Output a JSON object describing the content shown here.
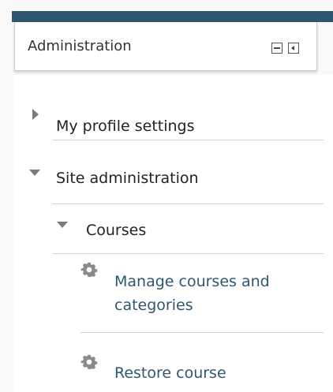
{
  "block": {
    "title": "Administration",
    "minimize_icon": "minimize-icon",
    "dock_icon": "dock-left-icon"
  },
  "nav": {
    "my_profile_settings": {
      "label": "My profile settings",
      "state": "collapsed"
    },
    "site_administration": {
      "label": "Site administration",
      "state": "expanded"
    },
    "courses": {
      "label": "Courses",
      "state": "expanded"
    },
    "links": [
      {
        "label_line1": "Manage courses and",
        "label_line2": "categories",
        "icon": "gear-icon"
      },
      {
        "label_line1": "Restore course",
        "icon": "gear-icon"
      }
    ]
  },
  "colors": {
    "header_bar": "#2f5671",
    "link": "#2f5671",
    "arrow": "#7a7a7a"
  }
}
